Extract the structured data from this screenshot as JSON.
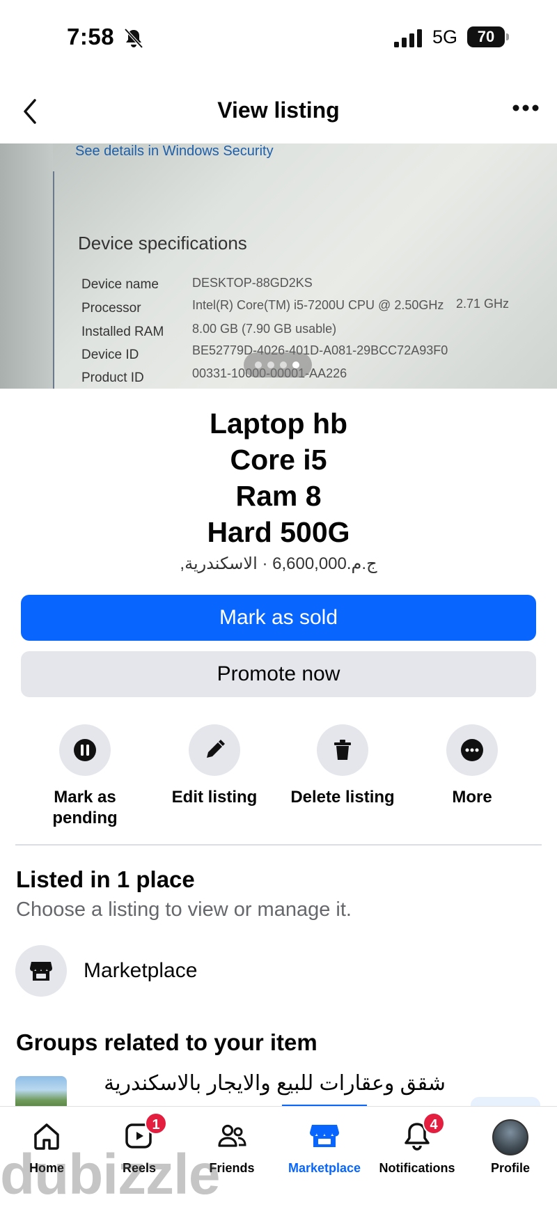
{
  "status_bar": {
    "time": "7:58",
    "network": "5G",
    "battery": "70"
  },
  "header": {
    "title": "View listing"
  },
  "photo": {
    "link_text": "See details in Windows Security",
    "heading": "Device specifications",
    "specs": [
      {
        "label": "Device name",
        "value": "DESKTOP-88GD2KS",
        "extra": ""
      },
      {
        "label": "Processor",
        "value": "Intel(R) Core(TM) i5-7200U CPU @ 2.50GHz",
        "extra": "2.71 GHz"
      },
      {
        "label": "Installed RAM",
        "value": "8.00 GB (7.90 GB usable)",
        "extra": ""
      },
      {
        "label": "Device ID",
        "value": "BE52779D-4026-401D-A081-29BCC72A93F0",
        "extra": ""
      },
      {
        "label": "Product ID",
        "value": "00331-10000-00001-AA226",
        "extra": ""
      }
    ],
    "page_count": 4,
    "active_page": 4
  },
  "listing": {
    "title_lines": [
      "Laptop hb",
      "Core i5",
      "Ram 8",
      "Hard 500G"
    ],
    "price_location": "ج.م.6,600,000 · الاسكندرية,"
  },
  "buttons": {
    "mark_sold": "Mark as sold",
    "promote": "Promote now"
  },
  "actions": [
    {
      "label_line1": "Mark as",
      "label_line2": "pending",
      "icon": "pause-icon"
    },
    {
      "label_line1": "Edit listing",
      "label_line2": "",
      "icon": "pencil-icon"
    },
    {
      "label_line1": "Delete listing",
      "label_line2": "",
      "icon": "trash-icon"
    },
    {
      "label_line1": "More",
      "label_line2": "",
      "icon": "more-icon"
    }
  ],
  "listed_section": {
    "title": "Listed in 1 place",
    "subtitle": "Choose a listing to view or manage it.",
    "item_label": "Marketplace"
  },
  "groups_section": {
    "title": "Groups related to your item",
    "first_group_name": "شقق وعقارات للبيع والايجار  بالاسكندرية"
  },
  "tabbar": {
    "tabs": [
      {
        "label": "Home",
        "icon": "home-icon",
        "badge": ""
      },
      {
        "label": "Reels",
        "icon": "reels-icon",
        "badge": "1"
      },
      {
        "label": "Friends",
        "icon": "friends-icon",
        "badge": ""
      },
      {
        "label": "Marketplace",
        "icon": "marketplace-icon",
        "badge": "",
        "active": true
      },
      {
        "label": "Notifications",
        "icon": "bell-icon",
        "badge": "4"
      },
      {
        "label": "Profile",
        "icon": "avatar",
        "badge": ""
      }
    ]
  },
  "watermark": "dubizzle",
  "colors": {
    "primary": "#0866ff",
    "secondary_bg": "#e4e6eb",
    "badge": "#e41e3f",
    "muted_text": "#65676b"
  }
}
